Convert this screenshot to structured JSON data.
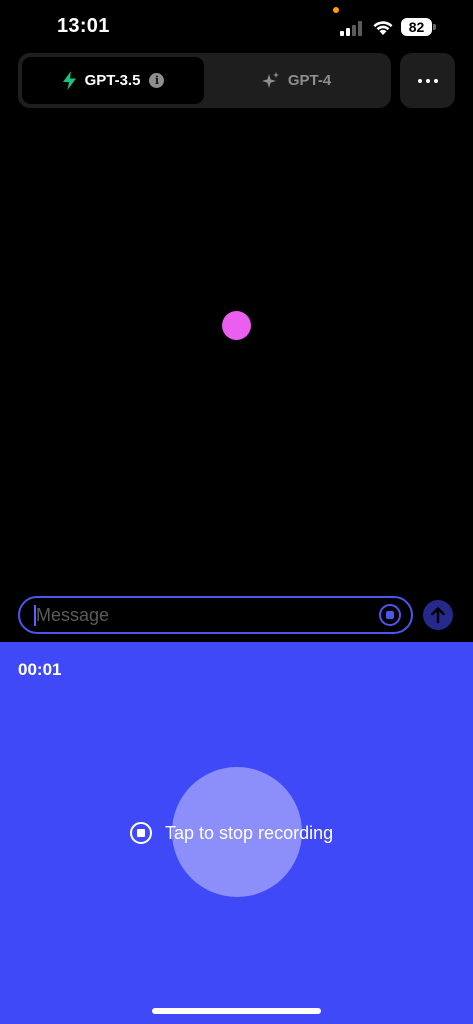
{
  "status_bar": {
    "time": "13:01",
    "battery": "82"
  },
  "model_selector": {
    "tabs": [
      {
        "label": "GPT-3.5",
        "icon": "lightning-icon",
        "active": true
      },
      {
        "label": "GPT-4",
        "icon": "sparkles-icon",
        "active": false
      }
    ]
  },
  "composer": {
    "placeholder": "Message"
  },
  "recording": {
    "timer": "00:01",
    "stop_label": "Tap to stop recording"
  },
  "colors": {
    "accent": "#4049f7",
    "orb": "#ea5ff0",
    "gpt35_icon": "#19c37d"
  }
}
